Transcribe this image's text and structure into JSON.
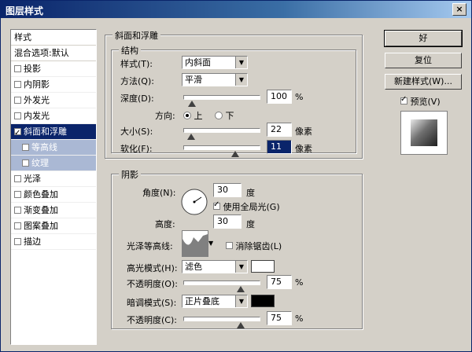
{
  "window": {
    "title": "图层样式",
    "close_glyph": "×"
  },
  "styles_panel": {
    "header": "样式",
    "blend_options": "混合选项:默认",
    "items": [
      {
        "label": "投影",
        "checked": false,
        "selected": false,
        "sub": false
      },
      {
        "label": "内阴影",
        "checked": false,
        "selected": false,
        "sub": false
      },
      {
        "label": "外发光",
        "checked": false,
        "selected": false,
        "sub": false
      },
      {
        "label": "内发光",
        "checked": false,
        "selected": false,
        "sub": false
      },
      {
        "label": "斜面和浮雕",
        "checked": true,
        "selected": true,
        "sub": false
      },
      {
        "label": "等高线",
        "checked": false,
        "selected": false,
        "sub": true
      },
      {
        "label": "纹理",
        "checked": false,
        "selected": false,
        "sub": true
      },
      {
        "label": "光泽",
        "checked": false,
        "selected": false,
        "sub": false
      },
      {
        "label": "颜色叠加",
        "checked": false,
        "selected": false,
        "sub": false
      },
      {
        "label": "渐变叠加",
        "checked": false,
        "selected": false,
        "sub": false
      },
      {
        "label": "图案叠加",
        "checked": false,
        "selected": false,
        "sub": false
      },
      {
        "label": "描边",
        "checked": false,
        "selected": false,
        "sub": false
      }
    ]
  },
  "bevel": {
    "group_title": "斜面和浮雕",
    "structure_title": "结构",
    "style_label": "样式(T):",
    "style_value": "内斜面",
    "technique_label": "方法(Q):",
    "technique_value": "平滑",
    "depth_label": "深度(D):",
    "depth_value": "100",
    "depth_unit": "%",
    "depth_fraction": 0.1,
    "direction_label": "方向:",
    "direction_up": "上",
    "direction_down": "下",
    "size_label": "大小(S):",
    "size_value": "22",
    "size_unit": "像素",
    "size_fraction": 0.09,
    "soften_label": "软化(F):",
    "soften_value": "11",
    "soften_unit": "像素",
    "soften_fraction": 0.68
  },
  "shading": {
    "title": "阴影",
    "angle_label": "角度(N):",
    "angle_value": "30",
    "angle_unit": "度",
    "global_light_label": "使用全局光(G)",
    "global_light_checked": true,
    "altitude_label": "高度:",
    "altitude_value": "30",
    "altitude_unit": "度",
    "gloss_contour_label": "光泽等高线:",
    "antialias_label": "消除锯齿(L)",
    "antialias_checked": false,
    "highlight_mode_label": "高光模式(H):",
    "highlight_mode_value": "滤色",
    "highlight_color": "#ffffff",
    "highlight_opacity_label": "不透明度(O):",
    "highlight_opacity_value": "75",
    "highlight_opacity_unit": "%",
    "highlight_opacity_fraction": 0.75,
    "shadow_mode_label": "暗调模式(S):",
    "shadow_mode_value": "正片叠底",
    "shadow_color": "#000000",
    "shadow_opacity_label": "不透明度(C):",
    "shadow_opacity_value": "75",
    "shadow_opacity_unit": "%",
    "shadow_opacity_fraction": 0.75
  },
  "buttons": {
    "ok": "好",
    "reset": "复位",
    "new_style": "新建样式(W)...",
    "preview_label": "预览(V)",
    "preview_checked": true
  }
}
